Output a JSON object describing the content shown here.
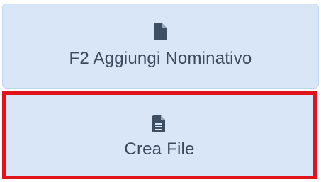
{
  "buttons": {
    "aggiungi_nominativo": {
      "label": "F2 Aggiungi Nominativo",
      "icon": "file-icon"
    },
    "crea_file": {
      "label": "Crea File",
      "icon": "file-text-icon",
      "highlight_color": "#e3131c"
    }
  },
  "colors": {
    "button_background": "#d8e6f7",
    "text": "#3b4a5e",
    "highlight": "#e3131c"
  }
}
